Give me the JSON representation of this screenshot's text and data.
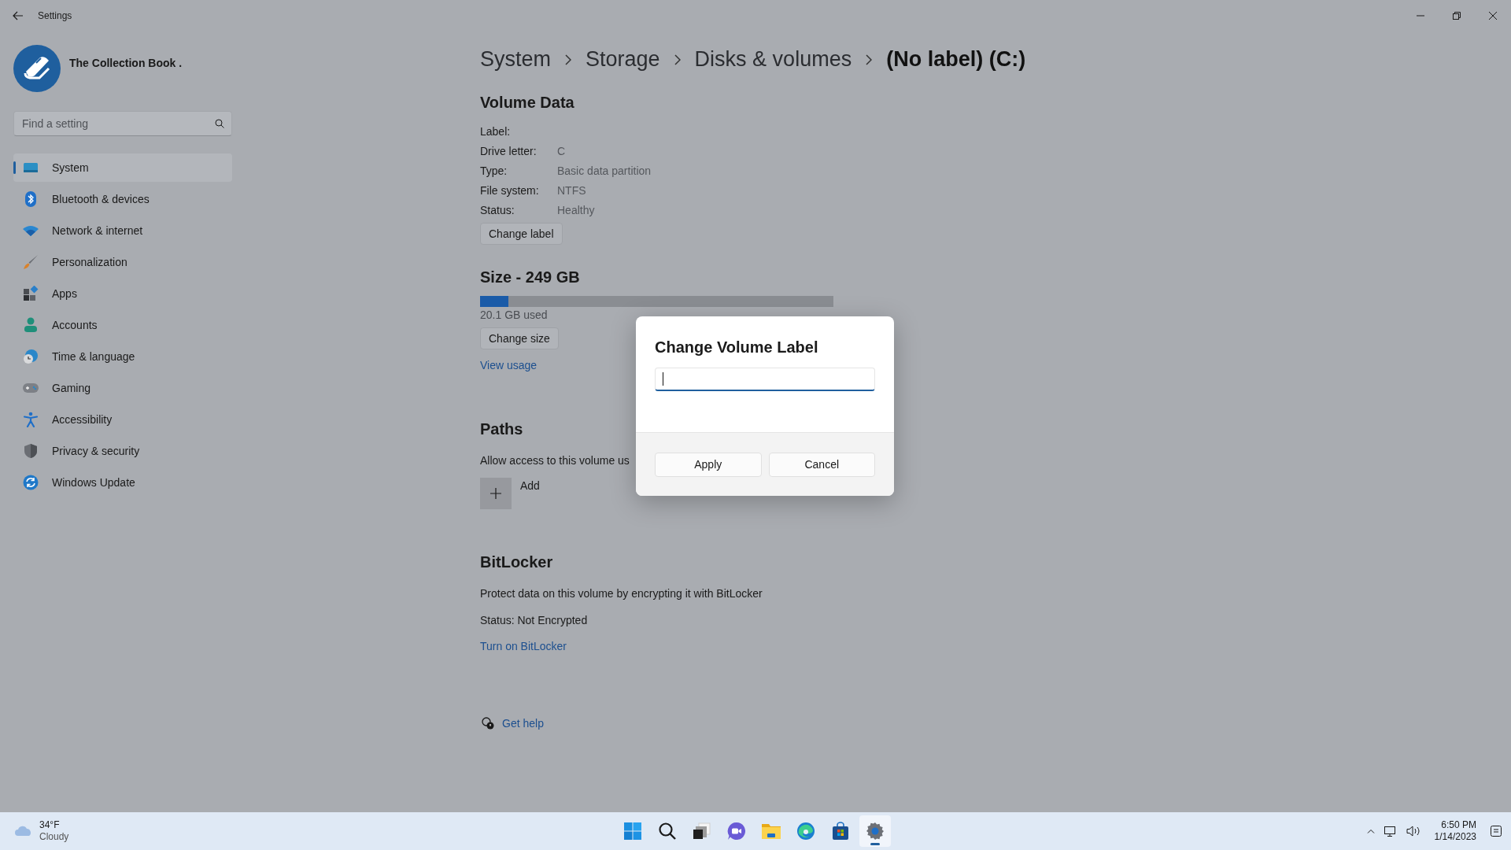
{
  "window": {
    "title": "Settings"
  },
  "account": {
    "name": "The Collection Book ."
  },
  "search": {
    "placeholder": "Find a setting"
  },
  "nav": [
    {
      "label": "System",
      "selected": true
    },
    {
      "label": "Bluetooth & devices",
      "selected": false
    },
    {
      "label": "Network & internet",
      "selected": false
    },
    {
      "label": "Personalization",
      "selected": false
    },
    {
      "label": "Apps",
      "selected": false
    },
    {
      "label": "Accounts",
      "selected": false
    },
    {
      "label": "Time & language",
      "selected": false
    },
    {
      "label": "Gaming",
      "selected": false
    },
    {
      "label": "Accessibility",
      "selected": false
    },
    {
      "label": "Privacy & security",
      "selected": false
    },
    {
      "label": "Windows Update",
      "selected": false
    }
  ],
  "breadcrumb": [
    {
      "label": "System",
      "current": false
    },
    {
      "label": "Storage",
      "current": false
    },
    {
      "label": "Disks & volumes",
      "current": false
    },
    {
      "label": "(No label) (C:)",
      "current": true
    }
  ],
  "volume_data": {
    "heading": "Volume Data",
    "fields": [
      {
        "label": "Label:"
      },
      {
        "label": "Drive letter:",
        "value": "C"
      },
      {
        "label": "Type:",
        "value": "Basic data partition"
      },
      {
        "label": "File system:",
        "value": "NTFS"
      },
      {
        "label": "Status:",
        "value": "Healthy"
      }
    ],
    "button": "Change label"
  },
  "size": {
    "heading": "Size - 249 GB",
    "level": 0.081,
    "used": "20.1 GB used",
    "button": "Change size",
    "link": "View usage"
  },
  "paths": {
    "heading": "Paths",
    "description": "Allow access to this volume us",
    "add_label": "Add"
  },
  "bitlocker": {
    "heading": "BitLocker",
    "description": "Protect data on this volume by encrypting it with BitLocker",
    "status": "Status: Not Encrypted",
    "link": "Turn on BitLocker"
  },
  "help": {
    "link": "Get help"
  },
  "dialog": {
    "title": "Change Volume Label",
    "input": {
      "focused": true
    },
    "buttons": [
      "Apply",
      "Cancel"
    ]
  },
  "taskbar": {
    "weather": {
      "temperature": "34°F",
      "condition": "Cloudy"
    },
    "apps": [
      {
        "selected": false
      },
      {
        "selected": false
      },
      {
        "selected": false
      },
      {
        "selected": false
      },
      {
        "selected": false
      },
      {
        "selected": false
      },
      {
        "selected": false
      },
      {
        "selected": true
      }
    ],
    "clock": {
      "time": "6:50 PM",
      "date": "1/14/2023"
    }
  }
}
